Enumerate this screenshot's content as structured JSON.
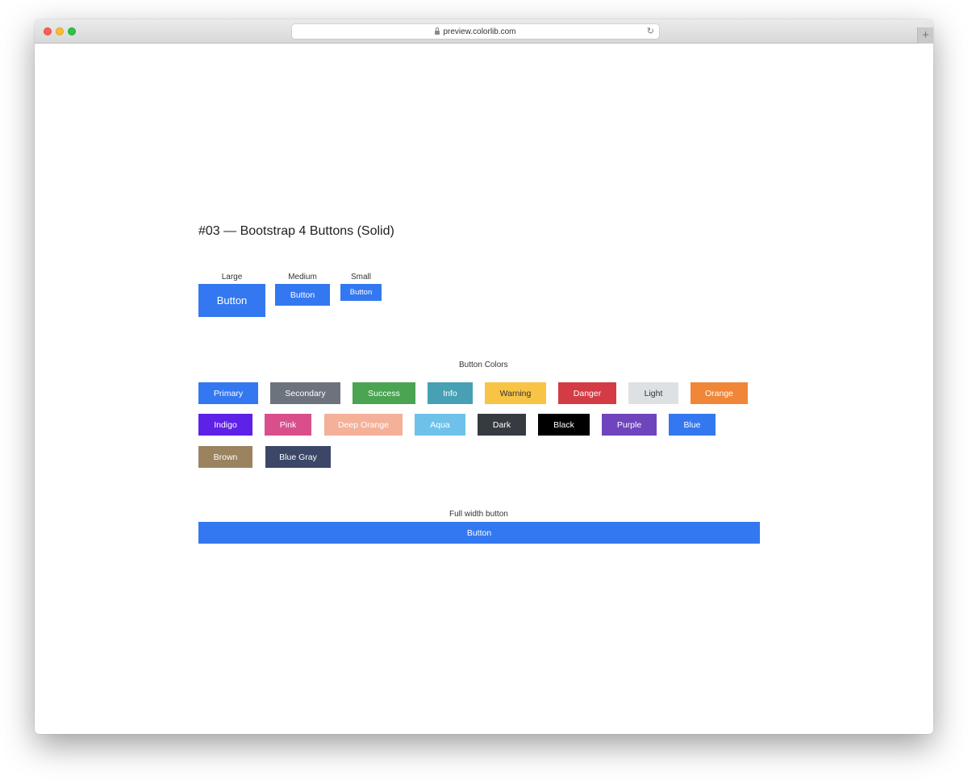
{
  "browser": {
    "url": "preview.colorlib.com",
    "new_tab_glyph": "+",
    "reload_glyph": "↻"
  },
  "page": {
    "heading": "#03 — Bootstrap 4 Buttons (Solid)",
    "sizes": {
      "large_label": "Large",
      "medium_label": "Medium",
      "small_label": "Small",
      "button_text": "Button"
    },
    "colors_label": "Button Colors",
    "color_buttons": [
      {
        "label": "Primary",
        "color": "#3378f0"
      },
      {
        "label": "Secondary",
        "color": "#6c737d"
      },
      {
        "label": "Success",
        "color": "#4aa452"
      },
      {
        "label": "Info",
        "color": "#47a0b3"
      },
      {
        "label": "Warning",
        "color": "#f7c446"
      },
      {
        "label": "Danger",
        "color": "#d33c45"
      },
      {
        "label": "Light",
        "color": "#dde1e4"
      },
      {
        "label": "Orange",
        "color": "#f08637"
      },
      {
        "label": "Indigo",
        "color": "#5e21e8"
      },
      {
        "label": "Pink",
        "color": "#d84f8c"
      },
      {
        "label": "Deep Orange",
        "color": "#f4b098"
      },
      {
        "label": "Aqua",
        "color": "#6ec2e9"
      },
      {
        "label": "Dark",
        "color": "#363b41"
      },
      {
        "label": "Black",
        "color": "#000000"
      },
      {
        "label": "Purple",
        "color": "#6f44bc"
      },
      {
        "label": "Blue",
        "color": "#3378f0"
      },
      {
        "label": "Brown",
        "color": "#9b8360"
      },
      {
        "label": "Blue Gray",
        "color": "#3c4767"
      }
    ],
    "full_width_label": "Full width button",
    "full_width_button": "Button",
    "primary_color": "#3378f0"
  }
}
